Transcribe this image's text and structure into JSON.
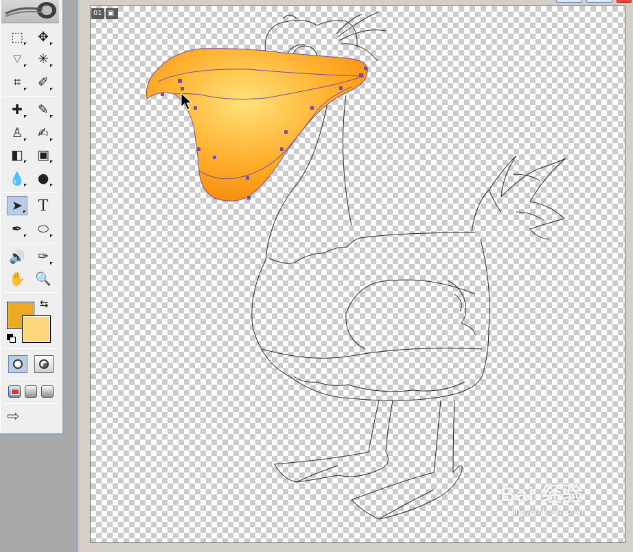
{
  "toolbox": {
    "tools": [
      {
        "name": "marquee-tool-icon",
        "glyph": "⬚"
      },
      {
        "name": "move-tool-icon",
        "glyph": "✥"
      },
      {
        "name": "lasso-tool-icon",
        "glyph": "⌔"
      },
      {
        "name": "magic-wand-tool-icon",
        "glyph": "✳"
      },
      {
        "name": "crop-tool-icon",
        "glyph": "⌗"
      },
      {
        "name": "slice-tool-icon",
        "glyph": "✐"
      },
      {
        "name": "healing-brush-tool-icon",
        "glyph": "✚"
      },
      {
        "name": "brush-tool-icon",
        "glyph": "✎"
      },
      {
        "name": "clone-stamp-tool-icon",
        "glyph": "♙"
      },
      {
        "name": "history-brush-tool-icon",
        "glyph": "✍"
      },
      {
        "name": "eraser-tool-icon",
        "glyph": "◧"
      },
      {
        "name": "gradient-tool-icon",
        "glyph": "▣"
      },
      {
        "name": "blur-tool-icon",
        "glyph": "💧"
      },
      {
        "name": "burn-tool-icon",
        "glyph": "●"
      },
      {
        "name": "direct-selection-tool-icon",
        "glyph": "➤"
      },
      {
        "name": "type-tool-icon",
        "glyph": "T"
      },
      {
        "name": "pen-tool-icon",
        "glyph": "✒"
      },
      {
        "name": "ellipse-tool-icon",
        "glyph": "⬭"
      },
      {
        "name": "notes-tool-icon",
        "glyph": "🔊"
      },
      {
        "name": "eyedropper-tool-icon",
        "glyph": "✑"
      },
      {
        "name": "hand-tool-icon",
        "glyph": "✋"
      },
      {
        "name": "zoom-tool-icon",
        "glyph": "🔍"
      }
    ],
    "foreground_color": "#EBAA22",
    "background_color": "#FDD87A",
    "swap_glyph": "⇆",
    "jump_glyph": "⇨"
  },
  "document": {
    "frame_number": "01",
    "frame_icon": "image-icon"
  },
  "watermark": {
    "brand": "Bai 经验",
    "url": "jingyan.baidu.com"
  },
  "colors": {
    "beak_light": "#FFE27A",
    "beak_mid": "#FFB02E",
    "beak_dark": "#F58A07",
    "anchor": "#7B4B9A",
    "outline": "#2a2a2a",
    "canvas_check": "#cccccc"
  }
}
